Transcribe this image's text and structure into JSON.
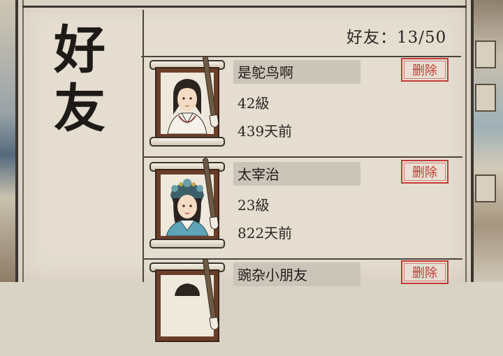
{
  "panel": {
    "title_chars": [
      "好",
      "友"
    ],
    "count_text": "好友：13/50"
  },
  "friends": [
    {
      "name": "是鸵鸟啊",
      "level": "42級",
      "last_seen": "439天前",
      "delete_label": "删除",
      "portrait": "scholar-portrait"
    },
    {
      "name": "太宰治",
      "level": "23級",
      "last_seen": "822天前",
      "delete_label": "删除",
      "portrait": "lady-portrait"
    },
    {
      "name": "豌杂小朋友",
      "level": "",
      "last_seen": "",
      "delete_label": "删除",
      "portrait": "portrait"
    }
  ],
  "colors": {
    "accent_red": "#c23a37",
    "ink": "#1d1a18",
    "paper": "#e4ddd0"
  }
}
